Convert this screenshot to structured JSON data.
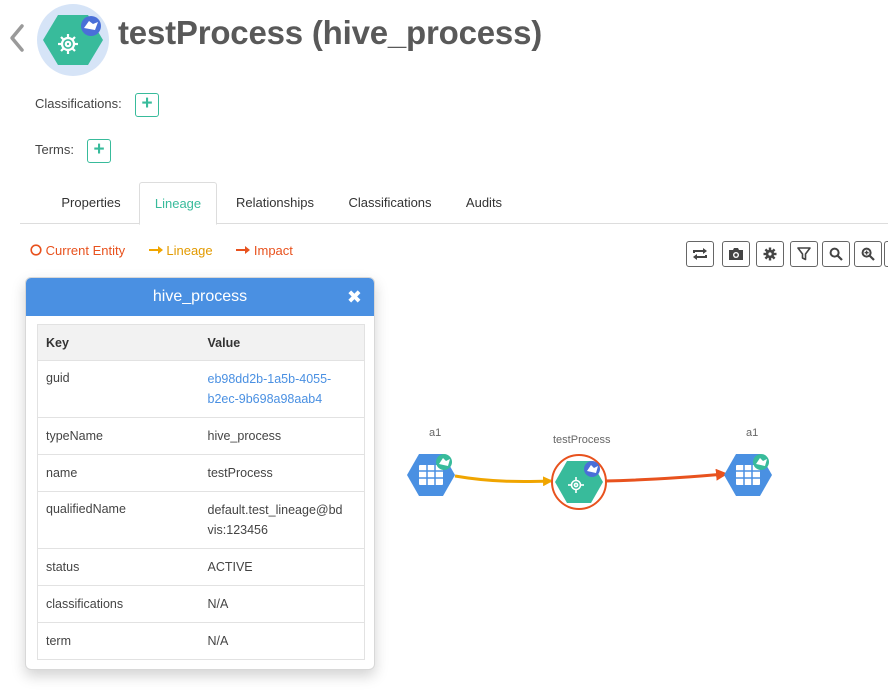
{
  "header": {
    "title": "testProcess (hive_process)"
  },
  "classifications_label": "Classifications:",
  "terms_label": "Terms:",
  "tabs": [
    {
      "label": "Properties"
    },
    {
      "label": "Lineage"
    },
    {
      "label": "Relationships"
    },
    {
      "label": "Classifications"
    },
    {
      "label": "Audits"
    }
  ],
  "legend": {
    "current": "Current Entity",
    "lineage": "Lineage",
    "impact": "Impact"
  },
  "colors": {
    "current": "#e8521e",
    "lineage": "#f0a500",
    "impact": "#e8521e",
    "accent": "#38bb9b",
    "panel_header": "#4a90e2"
  },
  "toolbar_icons": [
    "refresh-icon",
    "camera-icon",
    "gear-icon",
    "filter-icon",
    "search-icon",
    "zoom-in-icon"
  ],
  "panel": {
    "title": "hive_process",
    "col_key": "Key",
    "col_value": "Value",
    "rows": [
      {
        "key": "guid",
        "value_line1": "eb98dd2b-1a5b-4055-",
        "value_line2": "b2ec-9b698a98aab4"
      },
      {
        "key": "typeName",
        "value": "hive_process"
      },
      {
        "key": "name",
        "value": "testProcess"
      },
      {
        "key": "qualifiedName",
        "value_line1": "default.test_lineage@bd",
        "value_line2": "vis:123456"
      },
      {
        "key": "status",
        "value": "ACTIVE"
      },
      {
        "key": "classifications",
        "value": "N/A"
      },
      {
        "key": "term",
        "value": "N/A"
      }
    ]
  },
  "graph": {
    "nodes": [
      {
        "label": "a1"
      },
      {
        "label": "testProcess"
      },
      {
        "label": "a1"
      }
    ]
  }
}
